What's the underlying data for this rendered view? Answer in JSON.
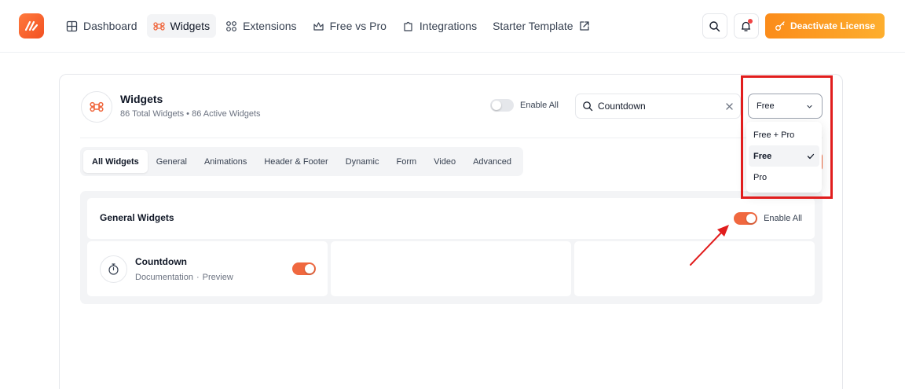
{
  "topbar": {
    "nav": [
      {
        "label": "Dashboard",
        "icon": "grid-icon"
      },
      {
        "label": "Widgets",
        "icon": "command-icon"
      },
      {
        "label": "Extensions",
        "icon": "extensions-icon"
      },
      {
        "label": "Free vs Pro",
        "icon": "crown-icon"
      },
      {
        "label": "Integrations",
        "icon": "puzzle-icon"
      },
      {
        "label": "Starter Template",
        "icon": "external-link-icon"
      }
    ],
    "deactivate_label": "Deactivate License"
  },
  "header": {
    "title": "Widgets",
    "subtitle": "86 Total Widgets • 86 Active Widgets",
    "enable_all_label": "Enable All",
    "enable_all_on": false,
    "search_value": "Countdown",
    "filter_value": "Free"
  },
  "tabs": [
    "All Widgets",
    "General",
    "Animations",
    "Header & Footer",
    "Dynamic",
    "Form",
    "Video",
    "Advanced"
  ],
  "section": {
    "title": "General Widgets",
    "enable_all_label": "Enable All",
    "enable_all_on": true
  },
  "widgets": [
    {
      "title": "Countdown",
      "doc_label": "Documentation",
      "separator": "·",
      "preview_label": "Preview",
      "enabled": true
    }
  ],
  "dropdown": {
    "options": [
      "Free + Pro",
      "Free",
      "Pro"
    ],
    "selected": "Free"
  },
  "colors": {
    "accent": "#f0683f",
    "annotation": "#e11d1d",
    "deactivate_start": "#fb8c1a",
    "deactivate_end": "#fdae2e"
  }
}
